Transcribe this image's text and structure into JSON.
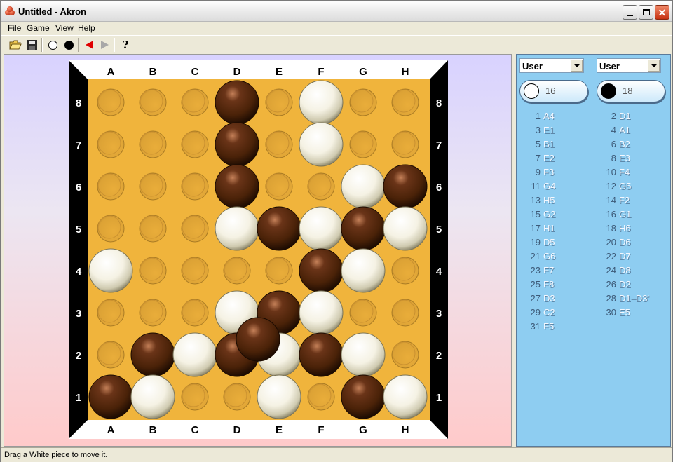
{
  "window": {
    "title": "Untitled - Akron"
  },
  "menu": {
    "file": "File",
    "game": "Game",
    "view": "View",
    "help": "Help"
  },
  "toolbar": {
    "help_glyph": "?"
  },
  "board": {
    "columns": [
      "A",
      "B",
      "C",
      "D",
      "E",
      "F",
      "G",
      "H"
    ],
    "rows": [
      "8",
      "7",
      "6",
      "5",
      "4",
      "3",
      "2",
      "1"
    ],
    "colors": {
      "frame": "#000000",
      "surface": "#f0b43c",
      "background_top": "#d8d2ff",
      "background_bottom": "#ffcaca"
    },
    "stones": [
      {
        "color": "black",
        "col": "D",
        "row": 8,
        "level": 0
      },
      {
        "color": "white",
        "col": "F",
        "row": 8,
        "level": 0
      },
      {
        "color": "black",
        "col": "D",
        "row": 7,
        "level": 0
      },
      {
        "color": "white",
        "col": "F",
        "row": 7,
        "level": 0
      },
      {
        "color": "black",
        "col": "D",
        "row": 6,
        "level": 0
      },
      {
        "color": "white",
        "col": "G",
        "row": 6,
        "level": 0
      },
      {
        "color": "black",
        "col": "H",
        "row": 6,
        "level": 0
      },
      {
        "color": "white",
        "col": "D",
        "row": 5,
        "level": 0
      },
      {
        "color": "black",
        "col": "E",
        "row": 5,
        "level": 0
      },
      {
        "color": "white",
        "col": "F",
        "row": 5,
        "level": 0
      },
      {
        "color": "black",
        "col": "G",
        "row": 5,
        "level": 0
      },
      {
        "color": "white",
        "col": "H",
        "row": 5,
        "level": 0
      },
      {
        "color": "white",
        "col": "A",
        "row": 4,
        "level": 0
      },
      {
        "color": "black",
        "col": "F",
        "row": 4,
        "level": 0
      },
      {
        "color": "white",
        "col": "G",
        "row": 4,
        "level": 0
      },
      {
        "color": "white",
        "col": "D",
        "row": 3,
        "level": 0
      },
      {
        "color": "black",
        "col": "E",
        "row": 3,
        "level": 0
      },
      {
        "color": "white",
        "col": "F",
        "row": 3,
        "level": 0
      },
      {
        "color": "black",
        "col": "B",
        "row": 2,
        "level": 0
      },
      {
        "color": "white",
        "col": "C",
        "row": 2,
        "level": 0
      },
      {
        "color": "black",
        "col": "D",
        "row": 2,
        "level": 0
      },
      {
        "color": "white",
        "col": "E",
        "row": 2,
        "level": 0
      },
      {
        "color": "black",
        "col": "F",
        "row": 2,
        "level": 0
      },
      {
        "color": "white",
        "col": "G",
        "row": 2,
        "level": 0
      },
      {
        "color": "black",
        "col": "A",
        "row": 1,
        "level": 0
      },
      {
        "color": "white",
        "col": "B",
        "row": 1,
        "level": 0
      },
      {
        "color": "white",
        "col": "E",
        "row": 1,
        "level": 0
      },
      {
        "color": "black",
        "col": "G",
        "row": 1,
        "level": 0
      },
      {
        "color": "white",
        "col": "H",
        "row": 1,
        "level": 0
      },
      {
        "color": "black",
        "col": "D3",
        "row": 2,
        "level": 1
      }
    ]
  },
  "players": {
    "white": {
      "type": "User",
      "count": "16"
    },
    "black": {
      "type": "User",
      "count": "18"
    }
  },
  "moves": {
    "white": [
      {
        "num": "1",
        "move": "A4"
      },
      {
        "num": "3",
        "move": "E1"
      },
      {
        "num": "5",
        "move": "B1"
      },
      {
        "num": "7",
        "move": "E2"
      },
      {
        "num": "9",
        "move": "F3"
      },
      {
        "num": "11",
        "move": "G4"
      },
      {
        "num": "13",
        "move": "H5"
      },
      {
        "num": "15",
        "move": "G2"
      },
      {
        "num": "17",
        "move": "H1"
      },
      {
        "num": "19",
        "move": "D5"
      },
      {
        "num": "21",
        "move": "G6"
      },
      {
        "num": "23",
        "move": "F7"
      },
      {
        "num": "25",
        "move": "F8"
      },
      {
        "num": "27",
        "move": "D3"
      },
      {
        "num": "29",
        "move": "C2"
      },
      {
        "num": "31",
        "move": "F5"
      }
    ],
    "black": [
      {
        "num": "2",
        "move": "D1"
      },
      {
        "num": "4",
        "move": "A1"
      },
      {
        "num": "6",
        "move": "B2"
      },
      {
        "num": "8",
        "move": "E3"
      },
      {
        "num": "10",
        "move": "F4"
      },
      {
        "num": "12",
        "move": "G5"
      },
      {
        "num": "14",
        "move": "F2"
      },
      {
        "num": "16",
        "move": "G1"
      },
      {
        "num": "18",
        "move": "H6"
      },
      {
        "num": "20",
        "move": "D6"
      },
      {
        "num": "22",
        "move": "D7"
      },
      {
        "num": "24",
        "move": "D8"
      },
      {
        "num": "26",
        "move": "D2"
      },
      {
        "num": "28",
        "move": "D1–D3'"
      },
      {
        "num": "30",
        "move": "E5"
      }
    ]
  },
  "status": {
    "text": "Drag a White piece to move it."
  }
}
